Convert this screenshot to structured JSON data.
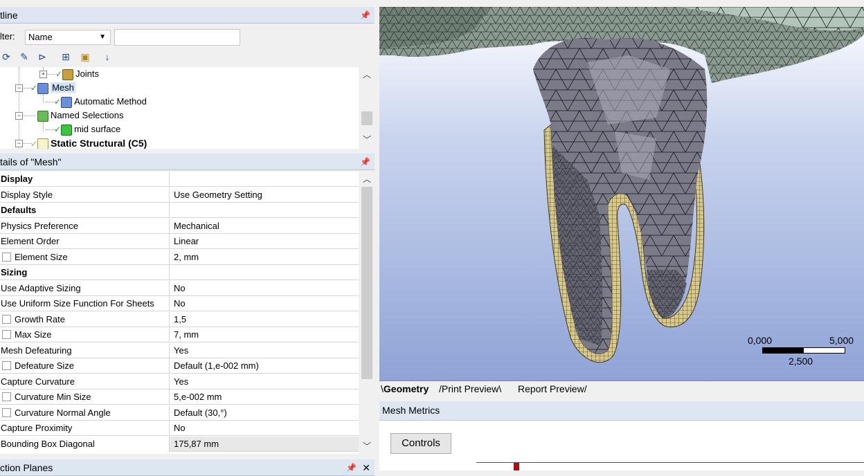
{
  "outline": {
    "title": "tline",
    "filter_label": "lter:",
    "filter_value": "Name",
    "filter_text": "",
    "tree": [
      {
        "label": "Joints"
      },
      {
        "label": "Mesh"
      },
      {
        "label": "Automatic Method"
      },
      {
        "label": "Named Selections"
      },
      {
        "label": "mid surface"
      },
      {
        "label": "Static Structural (C5)"
      }
    ]
  },
  "details": {
    "title": "tails of \"Mesh\"",
    "rows": [
      {
        "name": "Display",
        "value": ""
      },
      {
        "name": "Display Style",
        "value": "Use Geometry Setting"
      },
      {
        "name": "Defaults",
        "value": ""
      },
      {
        "name": "Physics Preference",
        "value": "Mechanical"
      },
      {
        "name": "Element Order",
        "value": "Linear"
      },
      {
        "name": "Element Size",
        "value": "2, mm"
      },
      {
        "name": "Sizing",
        "value": ""
      },
      {
        "name": "Use Adaptive Sizing",
        "value": "No"
      },
      {
        "name": "Use Uniform Size Function For Sheets",
        "value": "No"
      },
      {
        "name": "Growth Rate",
        "value": "1,5"
      },
      {
        "name": "Max Size",
        "value": "7, mm"
      },
      {
        "name": "Mesh Defeaturing",
        "value": "Yes"
      },
      {
        "name": "Defeature Size",
        "value": "Default (1,e-002 mm)"
      },
      {
        "name": "Capture Curvature",
        "value": "Yes"
      },
      {
        "name": "Curvature Min Size",
        "value": "5,e-002 mm"
      },
      {
        "name": "Curvature Normal Angle",
        "value": "Default (30,°)"
      },
      {
        "name": "Capture Proximity",
        "value": "No"
      },
      {
        "name": "Bounding Box Diagonal",
        "value": "175,87 mm"
      }
    ]
  },
  "section_planes": {
    "title": "ction Planes"
  },
  "viewport": {
    "scale_left": "0,000",
    "scale_right": "5,000",
    "scale_mid": "2,500"
  },
  "tabs": [
    "Geometry",
    "Print Preview",
    "Report Preview"
  ],
  "mesh_metrics": {
    "title": "Mesh Metrics",
    "controls_label": "Controls"
  },
  "colors": {
    "header": "#dde6f1",
    "check": "#2aa02a",
    "mesh_dark": "#5a5a66",
    "mesh_light": "#a8b8b0",
    "shell": "#d8c98a"
  }
}
